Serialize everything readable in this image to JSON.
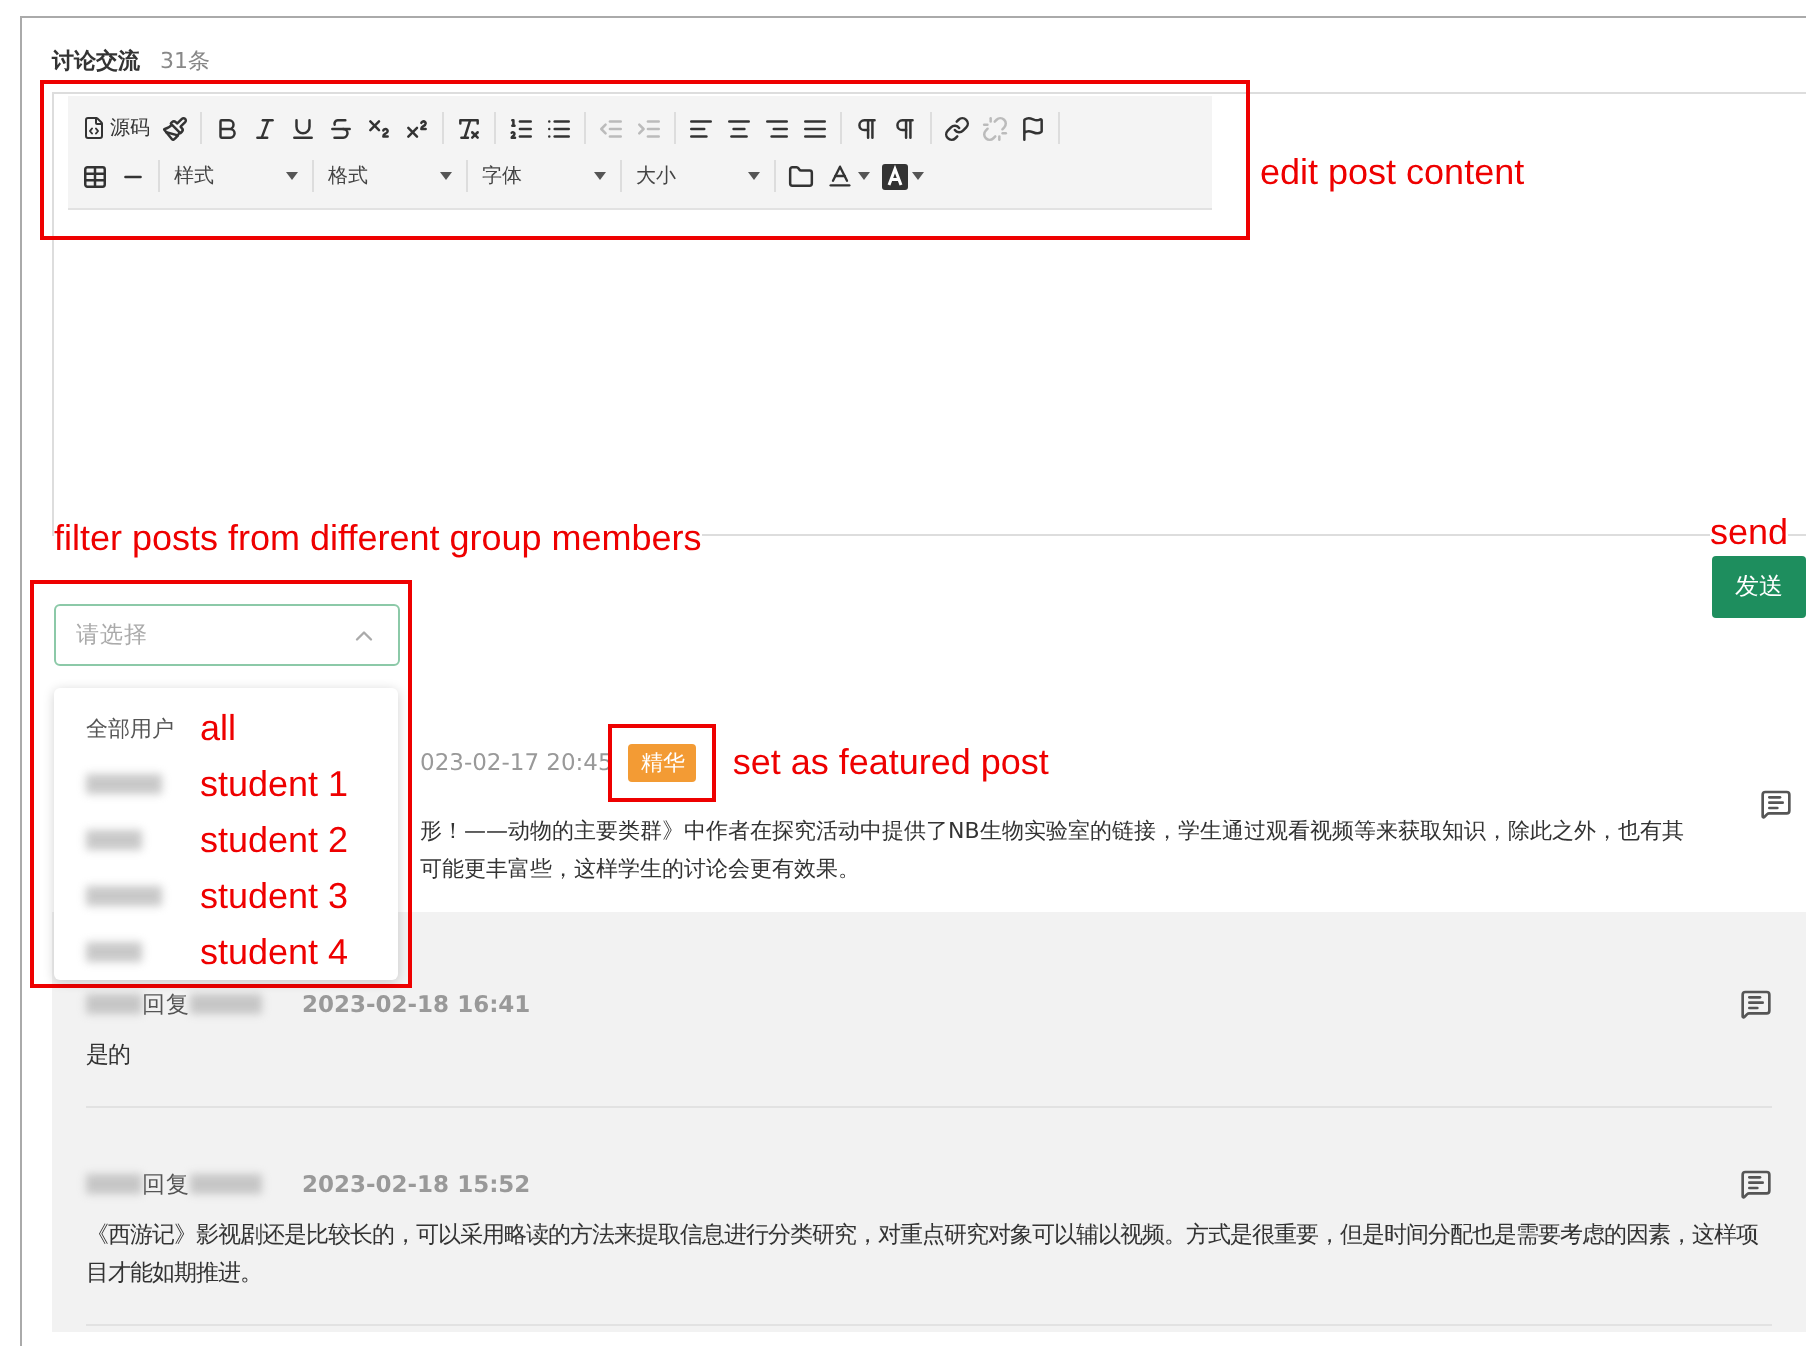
{
  "header": {
    "title": "讨论交流",
    "count": "31条"
  },
  "editor": {
    "annotation": "edit post content",
    "toolbar": [
      [
        {
          "kind": "source",
          "label": "源码",
          "disabled": false
        },
        {
          "kind": "paint",
          "disabled": false
        },
        {
          "kind": "separator"
        },
        {
          "kind": "bold",
          "disabled": false
        },
        {
          "kind": "italic",
          "disabled": false
        },
        {
          "kind": "underline",
          "disabled": false
        },
        {
          "kind": "strike",
          "disabled": false
        },
        {
          "kind": "subscript",
          "disabled": false
        },
        {
          "kind": "superscript",
          "disabled": false
        },
        {
          "kind": "separator"
        },
        {
          "kind": "removeformat",
          "disabled": false
        },
        {
          "kind": "separator"
        },
        {
          "kind": "ol",
          "disabled": false
        },
        {
          "kind": "ul",
          "disabled": false
        },
        {
          "kind": "separator"
        },
        {
          "kind": "outdent",
          "disabled": true
        },
        {
          "kind": "indent",
          "disabled": true
        },
        {
          "kind": "separator"
        },
        {
          "kind": "alignleft",
          "disabled": false
        },
        {
          "kind": "aligncenter",
          "disabled": false
        },
        {
          "kind": "alignright",
          "disabled": false
        },
        {
          "kind": "justify",
          "disabled": false
        },
        {
          "kind": "separator"
        },
        {
          "kind": "ltr",
          "disabled": false
        },
        {
          "kind": "rtl",
          "disabled": false
        },
        {
          "kind": "separator"
        },
        {
          "kind": "link",
          "disabled": false
        },
        {
          "kind": "unlink",
          "disabled": true
        },
        {
          "kind": "flag",
          "disabled": false
        },
        {
          "kind": "separator"
        }
      ],
      [
        {
          "kind": "table",
          "disabled": false
        },
        {
          "kind": "hr",
          "disabled": false
        },
        {
          "kind": "separator"
        },
        {
          "kind": "select",
          "label": "样式",
          "disabled": false
        },
        {
          "kind": "separator"
        },
        {
          "kind": "select",
          "label": "格式",
          "disabled": false
        },
        {
          "kind": "separator"
        },
        {
          "kind": "select",
          "label": "字体",
          "disabled": false
        },
        {
          "kind": "separator"
        },
        {
          "kind": "select",
          "label": "大小",
          "disabled": false
        },
        {
          "kind": "separator"
        },
        {
          "kind": "folder",
          "disabled": false
        },
        {
          "kind": "textcolor",
          "disabled": false
        },
        {
          "kind": "bgcolor",
          "disabled": false
        }
      ]
    ]
  },
  "filter": {
    "annotation": "filter posts from different group members",
    "placeholder": "请选择",
    "open": true,
    "options": [
      {
        "kind": "text",
        "label": "全部用户",
        "annotation": "all"
      },
      {
        "kind": "redacted",
        "annotation": "student 1"
      },
      {
        "kind": "redacted",
        "annotation": "student 2"
      },
      {
        "kind": "redacted",
        "annotation": "student 3"
      },
      {
        "kind": "redacted",
        "annotation": "student 4"
      }
    ]
  },
  "send": {
    "label": "发送",
    "annotation": "send"
  },
  "post": {
    "time": "023-02-17 20:45",
    "featured": true,
    "tag": "精华",
    "annotation": "set as featured post",
    "content_lines": [
      "形！——动物的主要类群》中作者在探究活动中提供了NB生物实验室的链接，学生通过观看视频等来获取知识，除此之外，也有其",
      "可能更丰富些，这样学生的讨论会更有效果。"
    ]
  },
  "replies": [
    {
      "verb": "回复",
      "time": "2023-02-18 16:41",
      "content": "是的"
    },
    {
      "verb": "回复",
      "time": "2023-02-18 15:52",
      "content": "《西游记》影视剧还是比较长的，可以采用略读的方法来提取信息进行分类研究，对重点研究对象可以辅以视频。方式是很重要，但是时间分配也是需要考虑的因素，这样项目才能如期推进。"
    }
  ]
}
